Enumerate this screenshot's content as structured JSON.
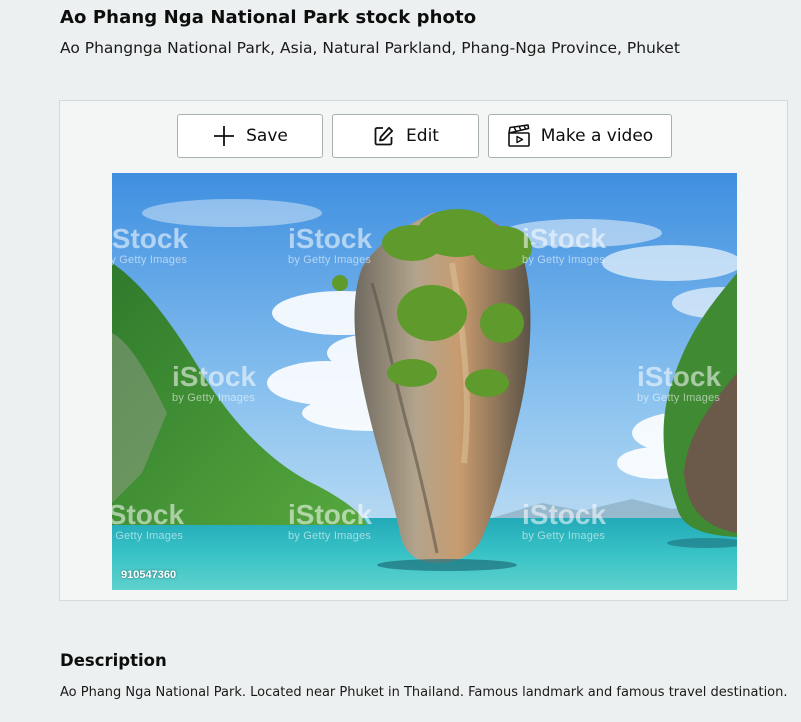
{
  "page": {
    "title": "Ao Phang Nga National Park stock photo",
    "subtitle": "Ao Phangnga National Park, Asia, Natural Parkland, Phang-Nga Province, Phuket"
  },
  "toolbar": {
    "save_label": "Save",
    "edit_label": "Edit",
    "video_label": "Make a video",
    "icons": [
      "plus-icon",
      "edit-icon",
      "clapperboard-icon"
    ]
  },
  "photo": {
    "watermark_brand": "iStock",
    "watermark_credit": "by Getty Images",
    "photo_id": "910547360"
  },
  "description": {
    "heading": "Description",
    "text": "Ao Phang Nga National Park. Located near Phuket in Thailand. Famous landmark and famous travel destination."
  },
  "colors": {
    "background": "#edf0f0",
    "panel": "#f4f6f6",
    "button_border": "#a9b0b0",
    "sea": "#2fb9bf",
    "sky": "#5fa8e8"
  }
}
